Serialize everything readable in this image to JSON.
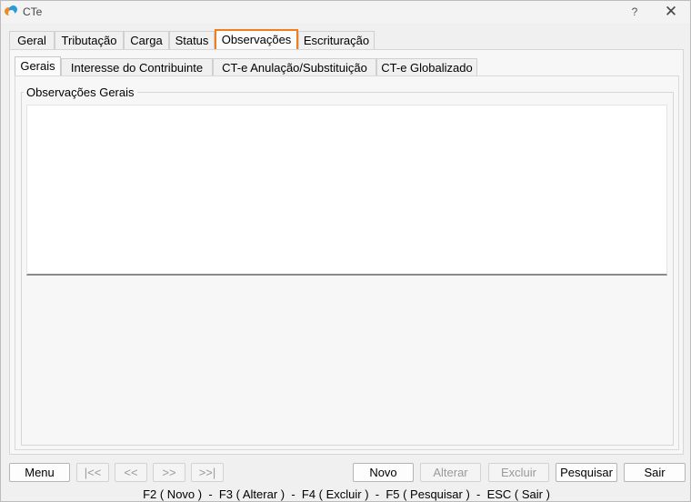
{
  "window": {
    "title": "CTe",
    "help_label": "?",
    "close_label": "✕"
  },
  "main_tabs": [
    {
      "label": "Geral"
    },
    {
      "label": "Tributação"
    },
    {
      "label": "Carga"
    },
    {
      "label": "Status"
    },
    {
      "label": "Observações",
      "active": true
    },
    {
      "label": "Escrituração"
    }
  ],
  "sub_tabs": [
    {
      "label": "Gerais",
      "active": true
    },
    {
      "label": "Interesse do Contribuinte"
    },
    {
      "label": "CT-e Anulação/Substituição"
    },
    {
      "label": "CT-e Globalizado"
    }
  ],
  "observacoes": {
    "group_label": "Observações Gerais",
    "value": ""
  },
  "buttons": {
    "menu": "Menu",
    "first": "|<<",
    "prev": "<<",
    "next": ">>",
    "last": ">>|",
    "novo": "Novo",
    "alterar": "Alterar",
    "excluir": "Excluir",
    "pesquisar": "Pesquisar",
    "sair": "Sair"
  },
  "shortcuts": "F2 ( Novo )  -  F3 ( Alterar )  -  F4 ( Excluir )  -  F5 ( Pesquisar )  -  ESC ( Sair )",
  "colors": {
    "active_tab_border": "#f07d1e",
    "app_icon_orange": "#f08a24",
    "app_icon_blue": "#2a9bd8"
  }
}
